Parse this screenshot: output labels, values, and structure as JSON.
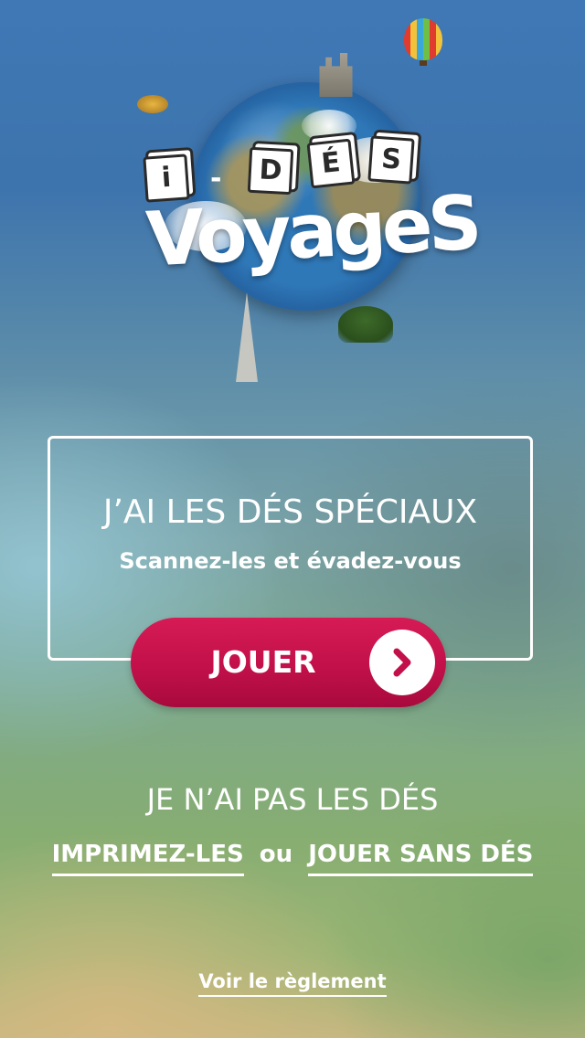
{
  "logo": {
    "dice_letters": [
      "i",
      "D",
      "É",
      "S"
    ],
    "dash": "-",
    "wordmark": "VoyageS"
  },
  "special_dice": {
    "title": "J’AI LES DÉS SPÉCIAUX",
    "subtitle": "Scannez-les et évadez-vous",
    "play_label": "JOUER",
    "play_icon": "chevron-right-icon",
    "accent_color": "#c2104a"
  },
  "no_dice": {
    "title": "JE N’AI PAS LES DÉS",
    "print_label": "IMPRIMEZ-LES",
    "or_label": "ou",
    "play_without_label": "JOUER SANS DÉS"
  },
  "footer": {
    "rules_label": "Voir le règlement"
  }
}
